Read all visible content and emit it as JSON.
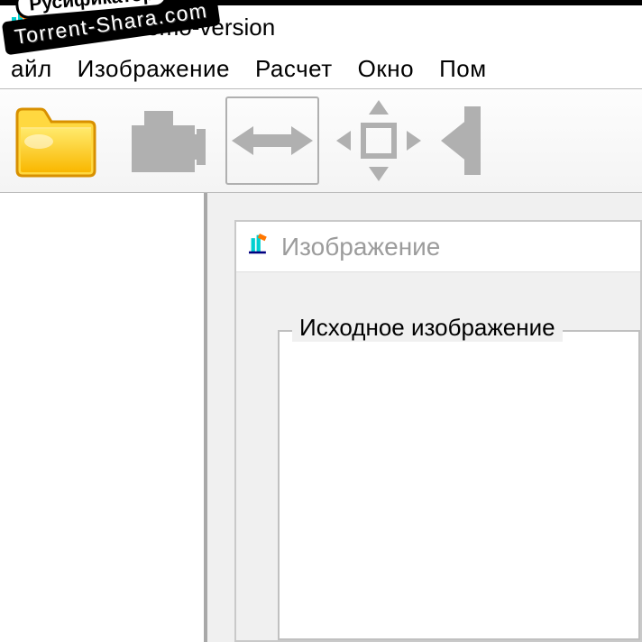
{
  "watermark": {
    "top": "Русификатор",
    "bottom": "Torrent-Shara.com"
  },
  "titlebar": {
    "title": "yzer 1.5 demo-version"
  },
  "menu": {
    "file": "айл",
    "image": "Изображение",
    "calc": "Расчет",
    "window": "Окно",
    "help": "Пом"
  },
  "toolbar": {
    "open": "open-folder-icon",
    "camera": "camera-icon",
    "flip": "flip-horizontal-icon",
    "fit": "fit-to-extents-icon",
    "nav": "nav-icon"
  },
  "childWindow": {
    "title": "Изображение",
    "groupLabel": "Исходное изображение"
  }
}
